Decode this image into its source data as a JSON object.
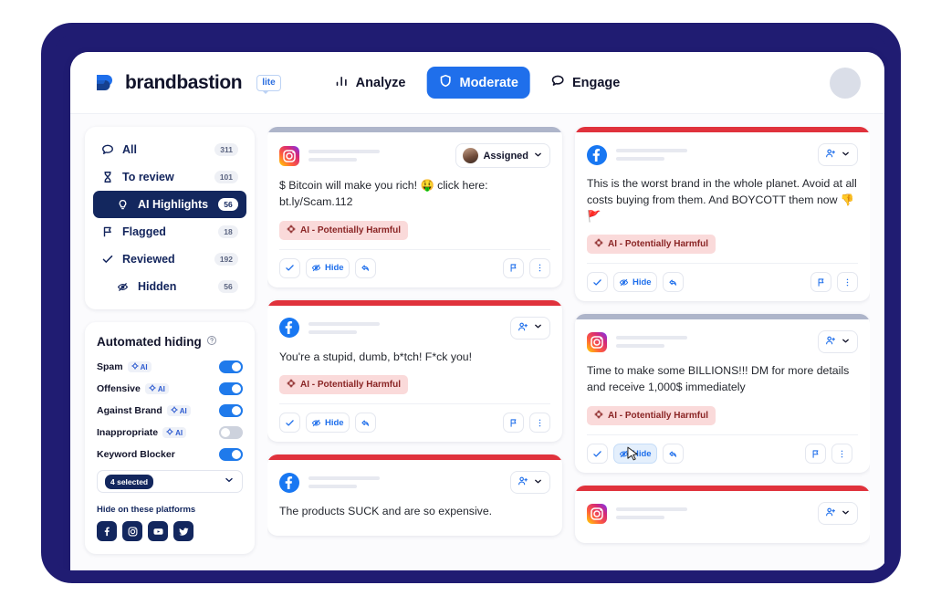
{
  "colors": {
    "frame_navy": "#201c72",
    "accent_blue": "#1f6feb",
    "sidebar_selected": "#13275e",
    "alert_red": "#e0323c",
    "muted_strip": "#aeb5ca",
    "badge_pink_bg": "#fadada",
    "badge_text": "#8a2525"
  },
  "topbar": {
    "brand_name": "brandbastion",
    "brand_badge": "lite",
    "logo_icon": "brandbastion-logo-icon",
    "avatar_icon": "user-avatar-placeholder",
    "nav": [
      {
        "label": "Analyze",
        "icon": "bar-chart-icon",
        "active": false
      },
      {
        "label": "Moderate",
        "icon": "shield-icon",
        "active": true
      },
      {
        "label": "Engage",
        "icon": "chat-bubble-icon",
        "active": false
      }
    ]
  },
  "sidebar": {
    "nav_items": [
      {
        "label": "All",
        "count": "311",
        "icon": "chat-bubble-icon",
        "selected": false,
        "sub": false
      },
      {
        "label": "To review",
        "count": "101",
        "icon": "hourglass-icon",
        "selected": false,
        "sub": false
      },
      {
        "label": "AI Highlights",
        "count": "56",
        "icon": "lightbulb-icon",
        "selected": true,
        "sub": true
      },
      {
        "label": "Flagged",
        "count": "18",
        "icon": "flag-icon",
        "selected": false,
        "sub": false
      },
      {
        "label": "Reviewed",
        "count": "192",
        "icon": "check-icon",
        "selected": false,
        "sub": false
      },
      {
        "label": "Hidden",
        "count": "56",
        "icon": "eye-off-icon",
        "selected": false,
        "sub": true
      }
    ],
    "automated_hiding": {
      "title": "Automated hiding",
      "help_icon": "help-circle-icon",
      "ai_chip_label": "AI",
      "ai_chip_icon": "cpu-chip-icon",
      "toggles": [
        {
          "label": "Spam",
          "ai": true,
          "on": true
        },
        {
          "label": "Offensive",
          "ai": true,
          "on": true
        },
        {
          "label": "Against Brand",
          "ai": true,
          "on": true
        },
        {
          "label": "Inappropriate",
          "ai": true,
          "on": false
        },
        {
          "label": "Keyword Blocker",
          "ai": false,
          "on": true
        }
      ],
      "select_value": "4 selected",
      "select_chevron_icon": "chevron-down-icon",
      "platforms_title": "Hide on these platforms",
      "platforms": [
        {
          "name": "facebook-icon"
        },
        {
          "name": "instagram-icon"
        },
        {
          "name": "youtube-icon"
        },
        {
          "name": "twitter-icon"
        }
      ]
    }
  },
  "feed": {
    "action_labels": {
      "approve": "",
      "hide": "Hide",
      "reply": "",
      "flag": "",
      "more": ""
    },
    "action_icons": {
      "approve": "check-icon",
      "hide": "eye-off-icon",
      "reply": "reply-arrow-icon",
      "flag": "flag-icon",
      "more": "more-vertical-icon"
    },
    "ai_badge_label": "AI - Potentially Harmful",
    "ai_badge_icon": "cpu-chip-icon",
    "assign_icon": "person-add-icon",
    "chevron_icon": "chevron-down-icon",
    "columns": [
      {
        "posts": [
          {
            "platform": "instagram-icon",
            "strip": "muted",
            "assign_label": "Assigned",
            "assign_has_avatar": true,
            "text": "$ Bitcoin will make you rich! 🤑 click here: bt.ly/Scam.112",
            "badge": "AI - Potentially Harmful",
            "has_actions": true,
            "hover_hide": false,
            "truncated": false
          },
          {
            "platform": "facebook-icon",
            "strip": "red",
            "assign_label": "",
            "assign_has_avatar": false,
            "text": "You're a stupid, dumb, b*tch! F*ck you!",
            "badge": "AI - Potentially Harmful",
            "has_actions": true,
            "hover_hide": false,
            "truncated": false
          },
          {
            "platform": "facebook-icon",
            "strip": "red",
            "assign_label": "",
            "assign_has_avatar": false,
            "text": "The products SUCK and are so expensive.",
            "badge": "",
            "has_actions": false,
            "hover_hide": false,
            "truncated": true
          }
        ]
      },
      {
        "posts": [
          {
            "platform": "facebook-icon",
            "strip": "red",
            "assign_label": "",
            "assign_has_avatar": false,
            "text": "This is the worst brand in the whole planet. Avoid at all costs buying from them. And BOYCOTT them now 👎🚩",
            "badge": "AI - Potentially Harmful",
            "has_actions": true,
            "hover_hide": false,
            "truncated": false
          },
          {
            "platform": "instagram-icon",
            "strip": "muted",
            "assign_label": "",
            "assign_has_avatar": false,
            "text": "Time to make some BILLIONS!!! DM for more details and receive 1,000$ immediately",
            "badge": "AI - Potentially Harmful",
            "has_actions": true,
            "hover_hide": true,
            "truncated": false
          },
          {
            "platform": "instagram-icon",
            "strip": "red",
            "assign_label": "",
            "assign_has_avatar": false,
            "text": "",
            "badge": "",
            "has_actions": false,
            "truncated": true
          }
        ]
      }
    ]
  }
}
